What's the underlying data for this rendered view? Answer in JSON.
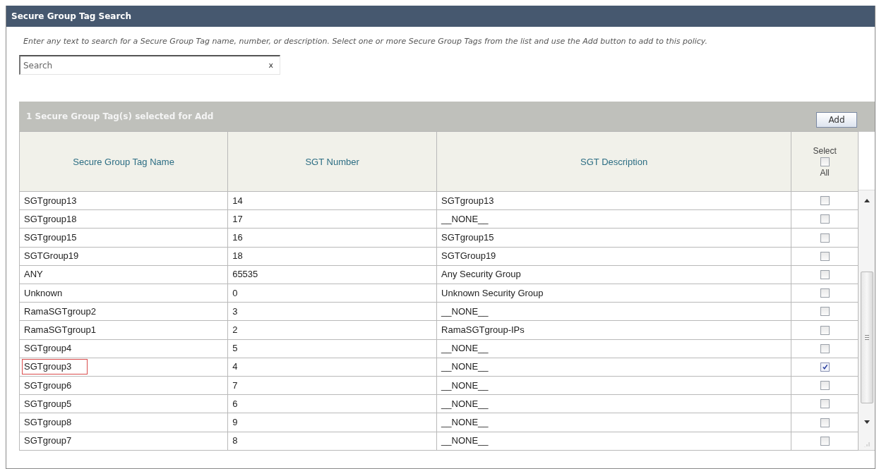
{
  "panel": {
    "title": "Secure Group Tag Search",
    "instructions": "Enter any text to search for a Secure Group Tag name, number, or description. Select one or more Secure Group Tags from the list and use the Add button to add to this policy.",
    "search": {
      "placeholder": "Search",
      "clear": "x"
    }
  },
  "table": {
    "caption": "1 Secure Group Tag(s) selected for Add",
    "add_button": "Add",
    "columns": [
      "Secure Group Tag Name",
      "SGT Number",
      "SGT Description"
    ],
    "select_all": {
      "label_top": "Select",
      "label_bottom": "All",
      "checked": false
    },
    "rows": [
      {
        "name": "SGTgroup13",
        "number": "14",
        "description": "SGTgroup13",
        "checked": false,
        "highlighted": false
      },
      {
        "name": "SGTgroup18",
        "number": "17",
        "description": "__NONE__",
        "checked": false,
        "highlighted": false
      },
      {
        "name": "SGTgroup15",
        "number": "16",
        "description": "SGTgroup15",
        "checked": false,
        "highlighted": false
      },
      {
        "name": "SGTGroup19",
        "number": "18",
        "description": "SGTGroup19",
        "checked": false,
        "highlighted": false
      },
      {
        "name": "ANY",
        "number": "65535",
        "description": "Any Security Group",
        "checked": false,
        "highlighted": false
      },
      {
        "name": "Unknown",
        "number": "0",
        "description": "Unknown Security Group",
        "checked": false,
        "highlighted": false
      },
      {
        "name": "RamaSGTgroup2",
        "number": "3",
        "description": "__NONE__",
        "checked": false,
        "highlighted": false
      },
      {
        "name": "RamaSGTgroup1",
        "number": "2",
        "description": "RamaSGTgroup-IPs",
        "checked": false,
        "highlighted": false
      },
      {
        "name": "SGTgroup4",
        "number": "5",
        "description": "__NONE__",
        "checked": false,
        "highlighted": false
      },
      {
        "name": "SGTgroup3",
        "number": "4",
        "description": "__NONE__",
        "checked": true,
        "highlighted": true
      },
      {
        "name": "SGTgroup6",
        "number": "7",
        "description": "__NONE__",
        "checked": false,
        "highlighted": false
      },
      {
        "name": "SGTgroup5",
        "number": "6",
        "description": "__NONE__",
        "checked": false,
        "highlighted": false
      },
      {
        "name": "SGTgroup8",
        "number": "9",
        "description": "__NONE__",
        "checked": false,
        "highlighted": false
      },
      {
        "name": "SGTgroup7",
        "number": "8",
        "description": "__NONE__",
        "checked": false,
        "highlighted": false
      }
    ]
  }
}
